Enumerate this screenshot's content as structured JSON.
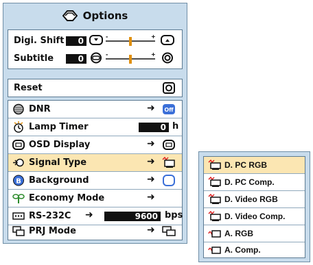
{
  "menu": {
    "title": "Options",
    "title_icon": "options-icon",
    "digi_shift": {
      "label": "Digi. Shift",
      "value": "0"
    },
    "subtitle": {
      "label": "Subtitle",
      "value": "0"
    },
    "reset": {
      "label": "Reset"
    },
    "items": [
      {
        "label": "DNR",
        "icon": "dnr-icon",
        "right": "off-badge"
      },
      {
        "label": "Lamp Timer",
        "icon": "lamp-timer-icon",
        "value": "0",
        "unit": "h"
      },
      {
        "label": "OSD Display",
        "icon": "osd-display-icon"
      },
      {
        "label": "Signal Type",
        "icon": "signal-type-icon",
        "selected": true
      },
      {
        "label": "Background",
        "icon": "background-icon"
      },
      {
        "label": "Economy Mode",
        "icon": "economy-mode-icon"
      },
      {
        "label": "RS-232C",
        "icon": "rs232c-icon",
        "value": "9600",
        "unit": "bps"
      },
      {
        "label": "PRJ Mode",
        "icon": "prj-mode-icon"
      }
    ]
  },
  "submenu": {
    "items": [
      {
        "label": "D. PC RGB",
        "icon": "digital-rgb-icon",
        "selected": true
      },
      {
        "label": "D. PC Comp.",
        "icon": "digital-comp-icon"
      },
      {
        "label": "D. Video RGB",
        "icon": "digital-video-rgb-icon"
      },
      {
        "label": "D. Video Comp.",
        "icon": "digital-video-comp-icon"
      },
      {
        "label": "A. RGB",
        "icon": "analog-rgb-icon"
      },
      {
        "label": "A. Comp.",
        "icon": "analog-comp-icon"
      }
    ]
  },
  "colors": {
    "panel": "#c8dcec",
    "selected": "#fbe6b2",
    "accent_blue": "#3a6fd8"
  }
}
